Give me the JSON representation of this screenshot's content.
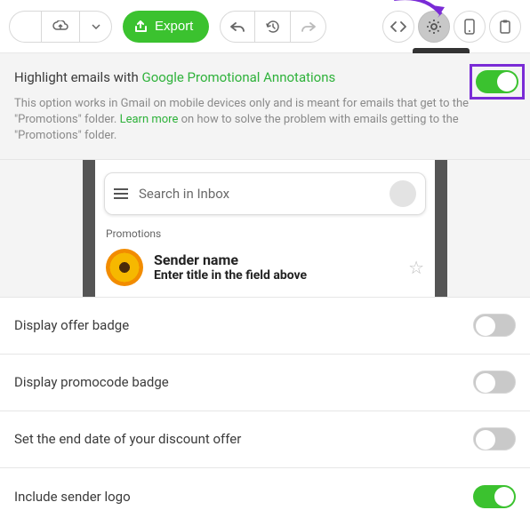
{
  "toolbar": {
    "export_label": "Export",
    "settings_tooltip": "Settings"
  },
  "highlight": {
    "title_prefix": "Highlight emails with ",
    "title_link": "Google Promotional Annotations",
    "desc_before": "This option works in Gmail on mobile devices only and is meant for emails that get to the \"Promotions\" folder. ",
    "desc_link": "Learn more",
    "desc_after": " on how to solve the problem with emails getting to the \"Promotions\" folder.",
    "toggle_on": true
  },
  "preview": {
    "search_placeholder": "Search in Inbox",
    "promotions_label": "Promotions",
    "sender": "Sender name",
    "title": "Enter title in the field above"
  },
  "options": [
    {
      "label": "Display offer badge",
      "on": false
    },
    {
      "label": "Display promocode badge",
      "on": false
    },
    {
      "label": "Set the end date of your discount offer",
      "on": false
    },
    {
      "label": "Include sender logo",
      "on": true
    }
  ]
}
